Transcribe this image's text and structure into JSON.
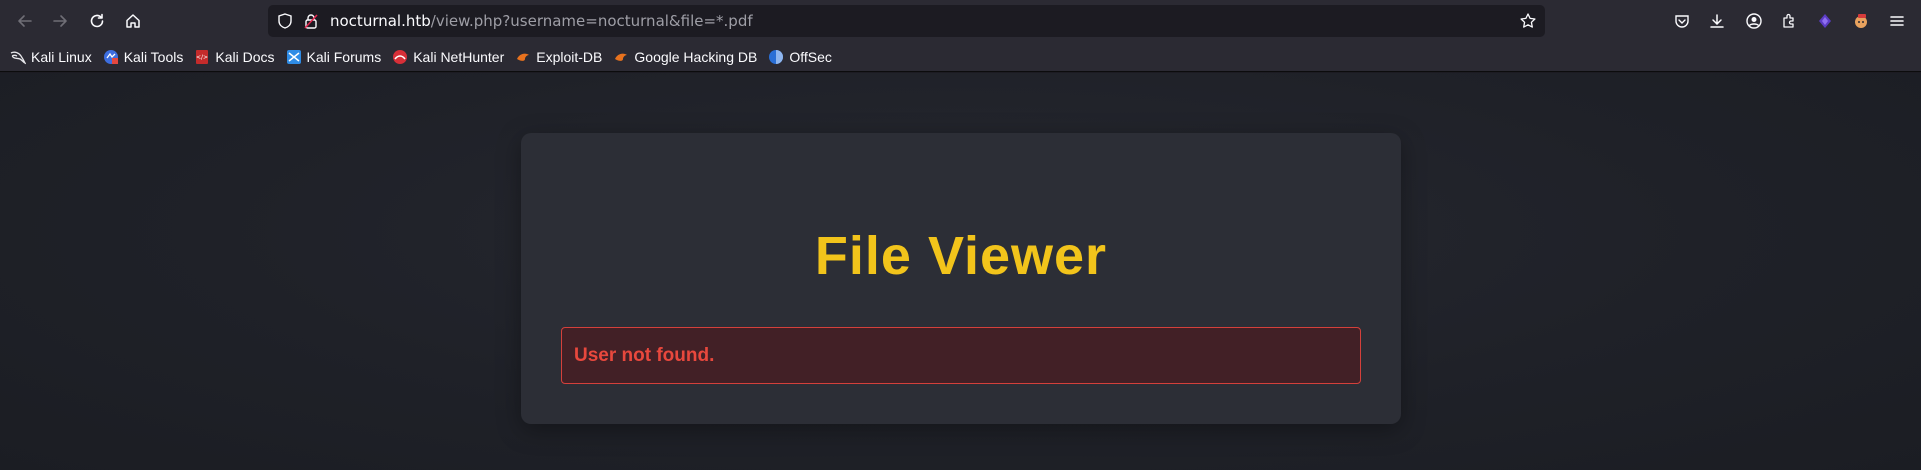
{
  "browser": {
    "url_host": "nocturnal.htb",
    "url_path": "/view.php?username=nocturnal&file=*.pdf",
    "nav": {
      "back_icon": "back-arrow-icon",
      "forward_icon": "forward-arrow-icon",
      "reload_icon": "reload-icon",
      "home_icon": "home-icon"
    },
    "toolbar_icons": [
      "pocket-icon",
      "download-icon",
      "account-icon",
      "extensions-icon",
      "firefox-view-icon",
      "profile-icon",
      "menu-icon"
    ],
    "accent": "#2b2a33"
  },
  "bookmarks": [
    {
      "label": "Kali Linux",
      "icon": "kali-dragon-icon"
    },
    {
      "label": "Kali Tools",
      "icon": "kali-tools-icon"
    },
    {
      "label": "Kali Docs",
      "icon": "kali-docs-icon"
    },
    {
      "label": "Kali Forums",
      "icon": "kali-forums-icon"
    },
    {
      "label": "Kali NetHunter",
      "icon": "nethunter-icon"
    },
    {
      "label": "Exploit-DB",
      "icon": "exploit-db-icon"
    },
    {
      "label": "Google Hacking DB",
      "icon": "ghdb-icon"
    },
    {
      "label": "OffSec",
      "icon": "offsec-icon"
    }
  ],
  "page": {
    "title": "File Viewer",
    "error_message": "User not found.",
    "colors": {
      "title": "#f2c41b",
      "error_text": "#e8483d",
      "error_border": "#d4403b"
    }
  }
}
